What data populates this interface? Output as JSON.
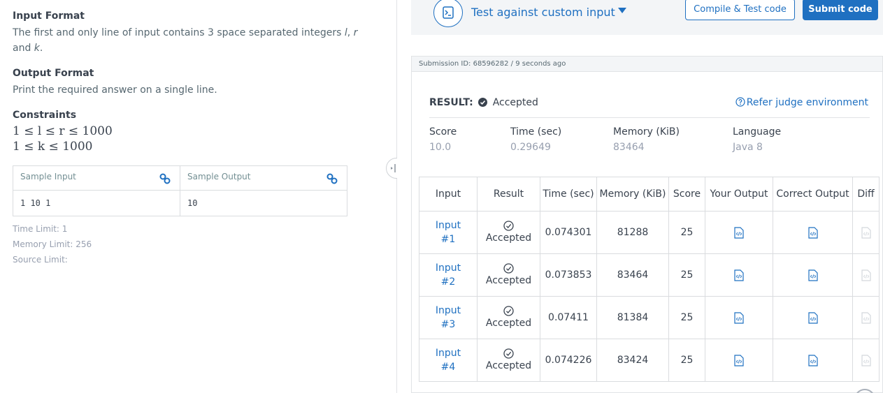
{
  "problem": {
    "input_format_heading": "Input Format",
    "input_format_text_1": "The first and only line of input contains 3 space separated integers",
    "var_l": "l",
    "var_r": "r",
    "input_format_text_2": "and",
    "var_k": "k",
    "output_format_heading": "Output Format",
    "output_format_text": "Print the required answer on a single line.",
    "constraints_heading": "Constraints",
    "constraint_1": "1 ≤ l ≤ r ≤ 1000",
    "constraint_2": "1 ≤ k ≤ 1000",
    "sample_input_label": "Sample Input",
    "sample_output_label": "Sample Output",
    "sample_input": "1 10 1",
    "sample_output": "10",
    "time_limit": "Time Limit: 1",
    "memory_limit": "Memory Limit: 256",
    "source_limit": "Source Limit:"
  },
  "toolbar": {
    "custom_input_label": "Test against custom input",
    "compile_label": "Compile & Test code",
    "submit_label": "Submit code"
  },
  "submission": {
    "id_line": "Submission ID: 68596282 / 9 seconds ago",
    "result_label": "RESULT:",
    "result_value": "Accepted",
    "refer_label": "Refer judge environment",
    "stats": {
      "score_label": "Score",
      "score": "10.0",
      "time_label": "Time (sec)",
      "time": "0.29649",
      "memory_label": "Memory (KiB)",
      "memory": "83464",
      "language_label": "Language",
      "language": "Java 8"
    },
    "table_headers": [
      "Input",
      "Result",
      "Time (sec)",
      "Memory (KiB)",
      "Score",
      "Your Output",
      "Correct Output",
      "Diff"
    ],
    "rows": [
      {
        "input": "Input #1",
        "result": "Accepted",
        "time": "0.074301",
        "memory": "81288",
        "score": "25"
      },
      {
        "input": "Input #2",
        "result": "Accepted",
        "time": "0.073853",
        "memory": "83464",
        "score": "25"
      },
      {
        "input": "Input #3",
        "result": "Accepted",
        "time": "0.07411",
        "memory": "81384",
        "score": "25"
      },
      {
        "input": "Input #4",
        "result": "Accepted",
        "time": "0.074226",
        "memory": "83424",
        "score": "25"
      }
    ]
  },
  "colors": {
    "accent": "#1f70c1",
    "text": "#39424e",
    "muted": "#979faf",
    "border": "#dadcdf"
  }
}
